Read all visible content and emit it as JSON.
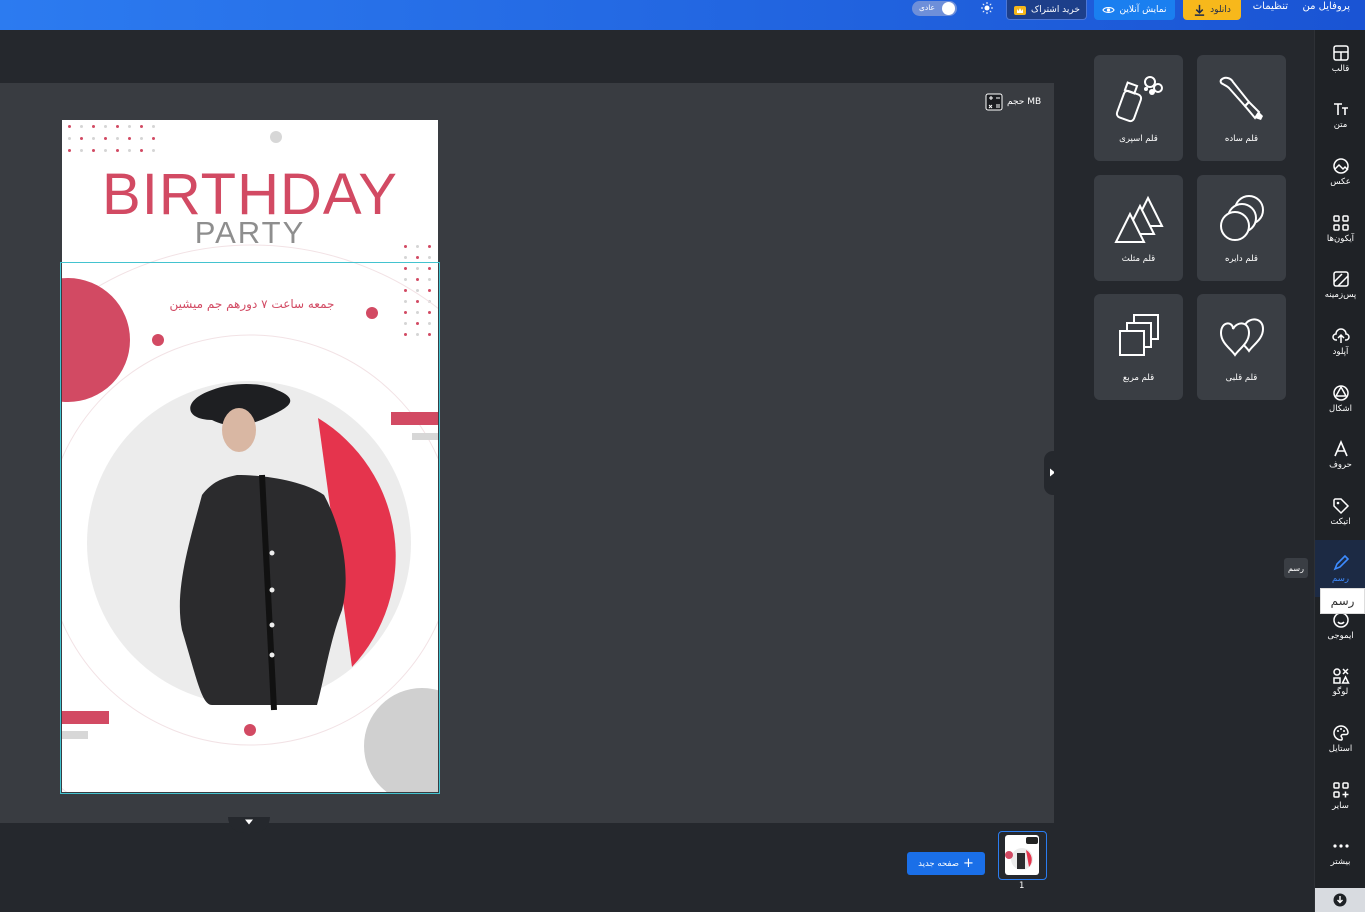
{
  "topbar": {
    "profile": "پروفایل من",
    "settings": "تنظیمات",
    "download": "دانلود",
    "online_preview": "نمایش آنلاین",
    "buy_subscription": "خرید اشتراک",
    "mode_label": "عادی",
    "colors": {
      "bar": "#1f5fe0",
      "download_bg": "#f7b81b",
      "preview_bg": "#1a7ff0"
    }
  },
  "canvas": {
    "size_label": "حجم MB",
    "design": {
      "title": "BIRTHDAY",
      "subtitle": "PARTY",
      "persian_line": "جمعه ساعت ۷ دورهم جم میشین",
      "accent": "#d24a63"
    }
  },
  "bottom": {
    "new_page": "صفحه جدید",
    "page_number": "1"
  },
  "tools": [
    {
      "label": "قلم ساده",
      "icon": "brush-icon"
    },
    {
      "label": "قلم اسپری",
      "icon": "spray-icon"
    },
    {
      "label": "قلم دایره",
      "icon": "circles-icon"
    },
    {
      "label": "قلم مثلث",
      "icon": "triangles-icon"
    },
    {
      "label": "قلم قلبی",
      "icon": "hearts-icon"
    },
    {
      "label": "قلم مربع",
      "icon": "squares-icon"
    }
  ],
  "sidebar": {
    "items": [
      {
        "label": "قالب",
        "icon": "template-icon"
      },
      {
        "label": "متن",
        "icon": "text-icon"
      },
      {
        "label": "عکس",
        "icon": "image-icon"
      },
      {
        "label": "آیکون‌ها",
        "icon": "grid-icon"
      },
      {
        "label": "پس‌زمینه",
        "icon": "background-icon"
      },
      {
        "label": "آپلود",
        "icon": "upload-icon"
      },
      {
        "label": "اشکال",
        "icon": "shapes-icon"
      },
      {
        "label": "حروف",
        "icon": "font-icon"
      },
      {
        "label": "اتیکت",
        "icon": "tag-icon"
      },
      {
        "label": "رسم",
        "icon": "pen-icon"
      },
      {
        "label": "ایموجی",
        "icon": "emoji-icon"
      },
      {
        "label": "لوگو",
        "icon": "logo-icon"
      },
      {
        "label": "استایل",
        "icon": "palette-icon"
      },
      {
        "label": "سایر",
        "icon": "apps-icon"
      },
      {
        "label": "بیشتر",
        "icon": "more-icon"
      }
    ],
    "active_badge": "رسم",
    "tooltip": "رسم"
  }
}
